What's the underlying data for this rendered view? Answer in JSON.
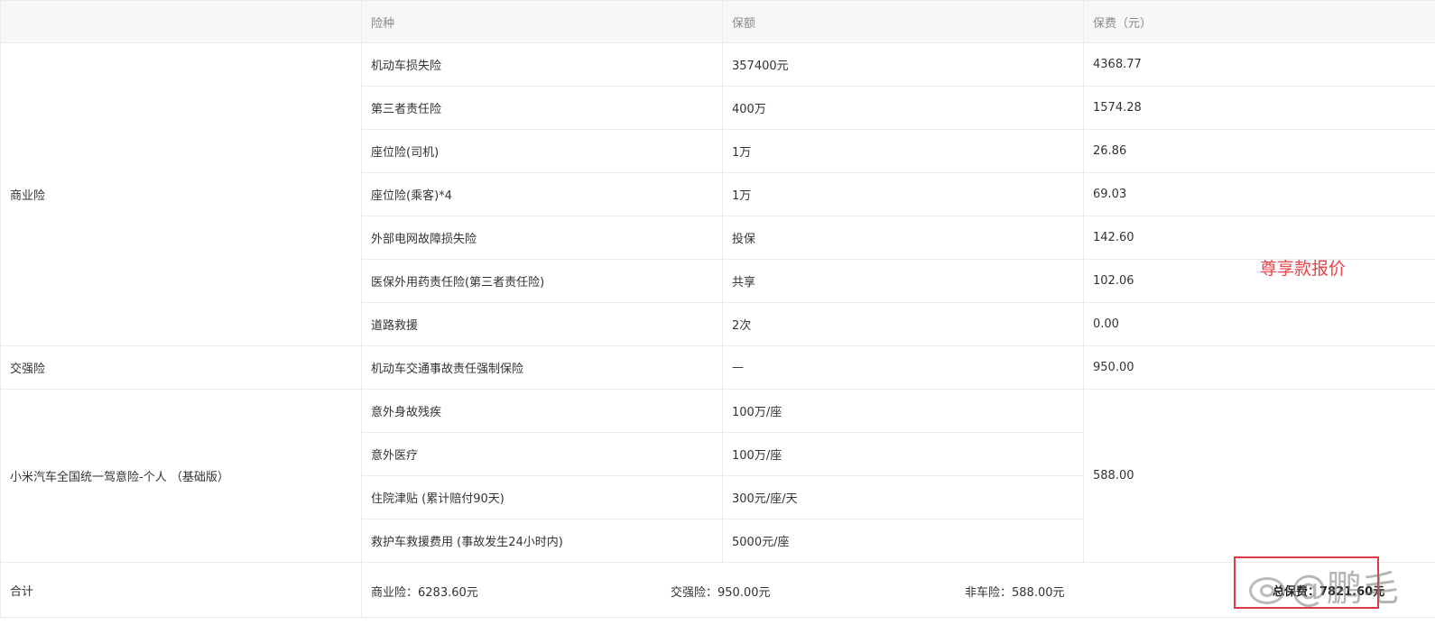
{
  "header": {
    "col1": "",
    "col2": "险种",
    "col3": "保额",
    "col4": "保费（元）"
  },
  "commercial": {
    "label": "商业险",
    "items": [
      {
        "name": "机动车损失险",
        "coverage": "357400元",
        "premium": "4368.77"
      },
      {
        "name": "第三者责任险",
        "coverage": "400万",
        "premium": "1574.28"
      },
      {
        "name": "座位险(司机)",
        "coverage": "1万",
        "premium": "26.86"
      },
      {
        "name": "座位险(乘客)*4",
        "coverage": "1万",
        "premium": "69.03"
      },
      {
        "name": "外部电网故障损失险",
        "coverage": "投保",
        "premium": "142.60"
      },
      {
        "name": "医保外用药责任险(第三者责任险)",
        "coverage": "共享",
        "premium": "102.06"
      },
      {
        "name": "道路救援",
        "coverage": "2次",
        "premium": "0.00"
      }
    ]
  },
  "compulsory": {
    "label": "交强险",
    "name": "机动车交通事故责任强制保险",
    "coverage": "—",
    "premium": "950.00"
  },
  "accident": {
    "label": "小米汽车全国统一驾意险-个人 （基础版）",
    "premium": "588.00",
    "items": [
      {
        "name": "意外身故残疾",
        "coverage": "100万/座"
      },
      {
        "name": "意外医疗",
        "coverage": "100万/座"
      },
      {
        "name": "住院津贴 (累计赔付90天)",
        "coverage": "300元/座/天"
      },
      {
        "name": "救护车救援费用 (事故发生24小时内)",
        "coverage": "5000元/座"
      }
    ]
  },
  "total": {
    "label": "合计",
    "commercial": "商业险：6283.60元",
    "compulsory": "交强险：950.00元",
    "non_vehicle": "非车险：588.00元",
    "grand": "总保费：7821.60元"
  },
  "annotation": "尊享款报价",
  "watermark": "@鹏毛",
  "colors": {
    "annotation": "#e8434a",
    "highlight_border": "#e0393e",
    "header_bg": "#f7f7f7",
    "border": "#ebebeb"
  }
}
